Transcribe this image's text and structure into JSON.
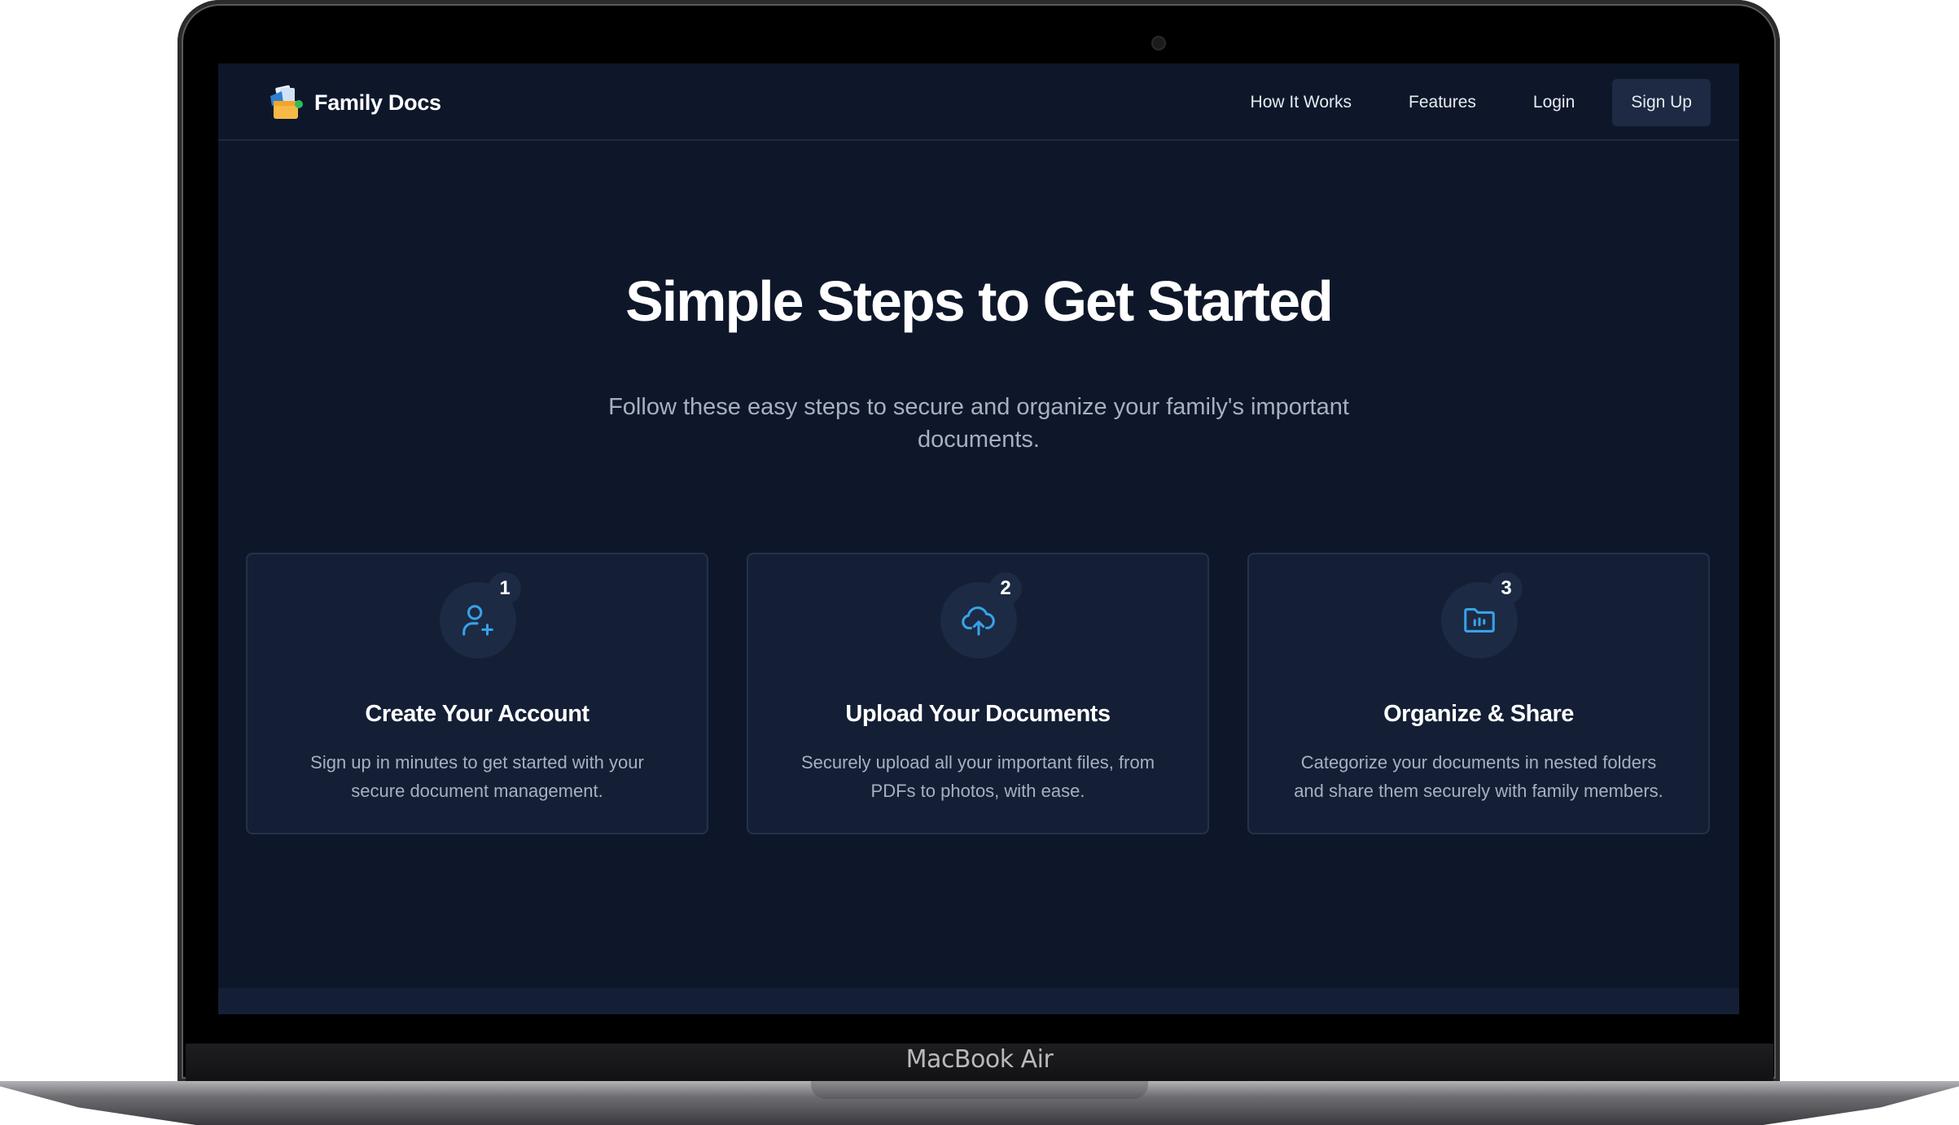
{
  "device": {
    "label": "MacBook Air"
  },
  "navbar": {
    "brand": "Family Docs",
    "links": [
      "How It Works",
      "Features",
      "Login"
    ],
    "cta": "Sign Up"
  },
  "hero": {
    "title": "Simple Steps to Get Started",
    "subtitle": "Follow these easy steps to secure and organize your family's important documents."
  },
  "steps": [
    {
      "number": "1",
      "icon": "user-plus-icon",
      "title": "Create Your Account",
      "description": "Sign up in minutes to get started with your secure document management."
    },
    {
      "number": "2",
      "icon": "cloud-upload-icon",
      "title": "Upload Your Documents",
      "description": "Securely upload all your important files, from PDFs to photos, with ease."
    },
    {
      "number": "3",
      "icon": "folder-chart-icon",
      "title": "Organize & Share",
      "description": "Categorize your documents in nested folders and share them securely with family members."
    }
  ],
  "colors": {
    "background": "#0e172a",
    "card": "#141f36",
    "accent": "#38a2e8",
    "text": "#ffffff",
    "muted": "#a6b0c0"
  }
}
